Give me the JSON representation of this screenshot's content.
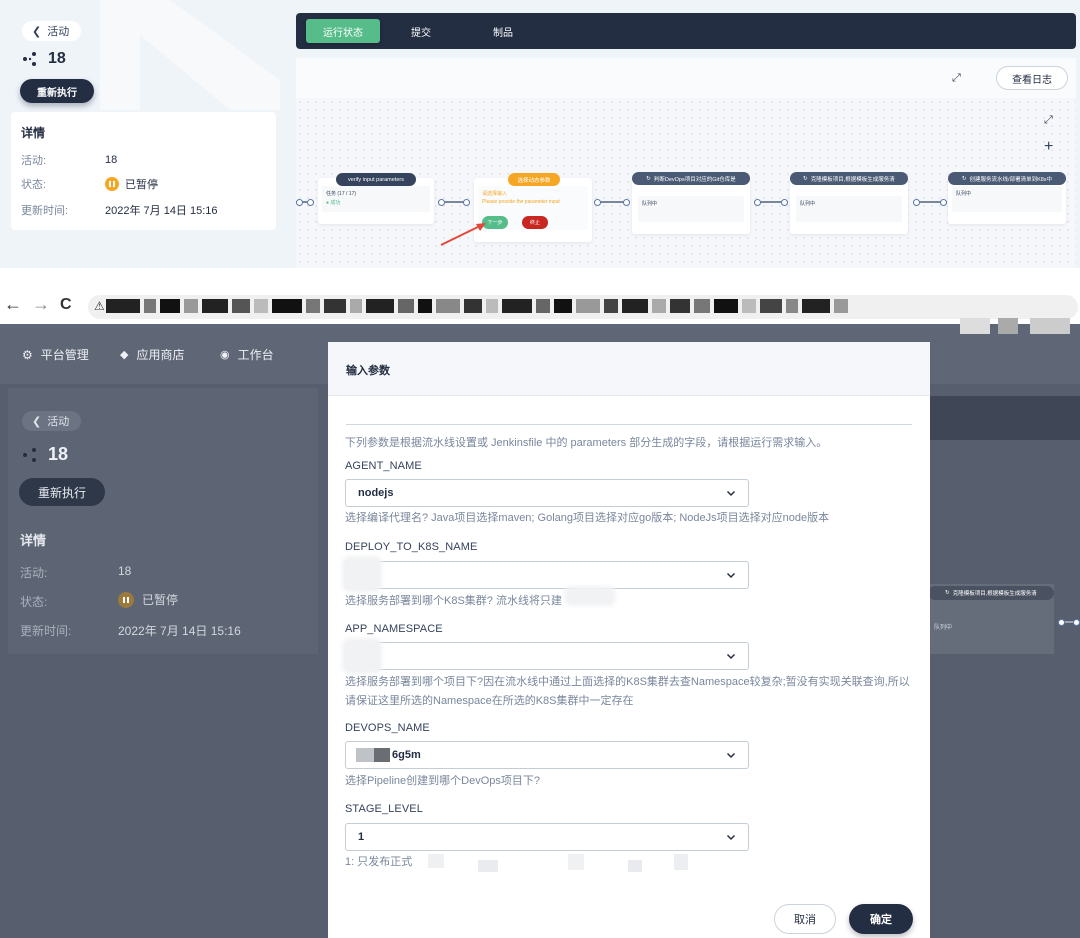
{
  "top": {
    "back_label": "活动",
    "run_id": "18",
    "rerun_label": "重新执行",
    "detail_title": "详情",
    "details": [
      {
        "key": "活动:",
        "value": "18"
      },
      {
        "key": "状态:",
        "value": "已暂停"
      },
      {
        "key": "更新时间:",
        "value": "2022年 7月 14日 15:16"
      }
    ],
    "tabs": [
      "运行状态",
      "提交",
      "制品"
    ],
    "view_log_label": "查看日志",
    "stages": [
      {
        "title": "verify input parameters",
        "body": "任务 (17 / 17)",
        "status": "● 成功"
      },
      {
        "title": "选择动态参数",
        "body": "请选择输入",
        "hint": "Please provide the parameter input",
        "next": "下一步",
        "stop": "终止"
      },
      {
        "title": "判断DevOps项目对应的Git仓库是",
        "body": "队列中"
      },
      {
        "title": "克隆模板项目,根据模板生成服务清",
        "body": "队列中"
      },
      {
        "title": "创建服务流水线/部署清单到K8s中",
        "body": "队列中"
      }
    ],
    "colors": {
      "accent_green": "#55bc8a",
      "dark": "#242e42",
      "orange": "#f5a623",
      "stop_red": "#ca2621"
    }
  },
  "browser": {
    "back": "←",
    "forward": "→",
    "reload": "C"
  },
  "app_nav": [
    {
      "icon": "gear-icon",
      "label": "平台管理"
    },
    {
      "icon": "store-icon",
      "label": "应用商店"
    },
    {
      "icon": "workbench-icon",
      "label": "工作台"
    }
  ],
  "bg": {
    "back_label": "活动",
    "run_id": "18",
    "rerun_label": "重新执行",
    "detail_title": "详情",
    "details": [
      {
        "key": "活动:",
        "value": "18"
      },
      {
        "key": "状态:",
        "value": "已暂停"
      },
      {
        "key": "更新时间:",
        "value": "2022年 7月 14日 15:16"
      }
    ],
    "stage_right": "克隆模板项目,根据模板生成服务清",
    "stage_right_body": "队列中"
  },
  "modal": {
    "title": "输入参数",
    "intro": "下列参数是根据流水线设置或 Jenkinsfile 中的 parameters 部分生成的字段，请根据运行需求输入。",
    "fields": [
      {
        "name": "AGENT_NAME",
        "value": "nodejs",
        "desc": "选择编译代理名? Java项目选择maven; Golang项目选择对应go版本; NodeJs项目选择对应node版本"
      },
      {
        "name": "DEPLOY_TO_K8S_NAME",
        "value": "",
        "desc": "选择服务部署到哪个K8S集群? 流水线将只建"
      },
      {
        "name": "APP_NAMESPACE",
        "value": "",
        "desc": "选择服务部署到哪个项目下?因在流水线中通过上面选择的K8S集群去查Namespace较复杂;暂没有实现关联查询,所以请保证这里所选的Namespace在所选的K8S集群中一定存在"
      },
      {
        "name": "DEVOPS_NAME",
        "value": "6g5m",
        "desc": "选择Pipeline创建到哪个DevOps项目下?"
      },
      {
        "name": "STAGE_LEVEL",
        "value": "1",
        "desc": "1: 只发布正式"
      }
    ],
    "cancel_label": "取消",
    "ok_label": "确定"
  }
}
